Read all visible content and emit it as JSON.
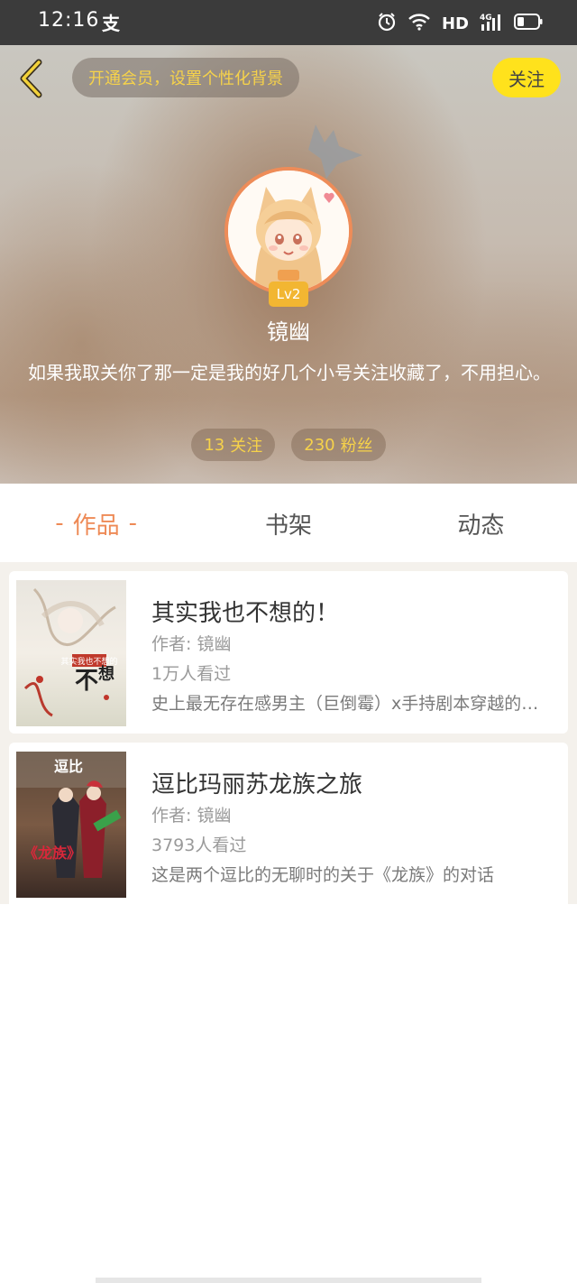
{
  "status_bar": {
    "time": "12:16",
    "ime_indicator": "支",
    "network_label": "HD",
    "signal_label": "4G"
  },
  "header": {
    "vip_banner": "开通会员，设置个性化背景",
    "follow_label": "关注",
    "level": "Lv2",
    "username": "镜幽",
    "bio": "如果我取关你了那一定是我的好几个小号关注收藏了，不用担心。",
    "following_count": "13",
    "following_label": "关注",
    "fans_count": "230",
    "fans_label": "粉丝"
  },
  "tabs": [
    {
      "label": "作品",
      "active": true
    },
    {
      "label": "书架",
      "active": false
    },
    {
      "label": "动态",
      "active": false
    }
  ],
  "works": [
    {
      "title": "其实我也不想的！",
      "author": "作者: 镜幽",
      "views": "1万人看过",
      "description": "史上最无存在感男主（巨倒霉）x手持剧本穿越的…",
      "cover_text": "其实我也不想的"
    },
    {
      "title": "逗比玛丽苏龙族之旅",
      "author": "作者: 镜幽",
      "views": "3793人看过",
      "description": "这是两个逗比的无聊时的关于《龙族》的对话",
      "cover_text_top": "逗比",
      "cover_text_bottom": "《龙族》"
    }
  ],
  "colors": {
    "accent": "#ee8a56",
    "follow_button": "#ffe21c",
    "chip_text": "#f6d24a",
    "level_badge": "#f2b632"
  }
}
